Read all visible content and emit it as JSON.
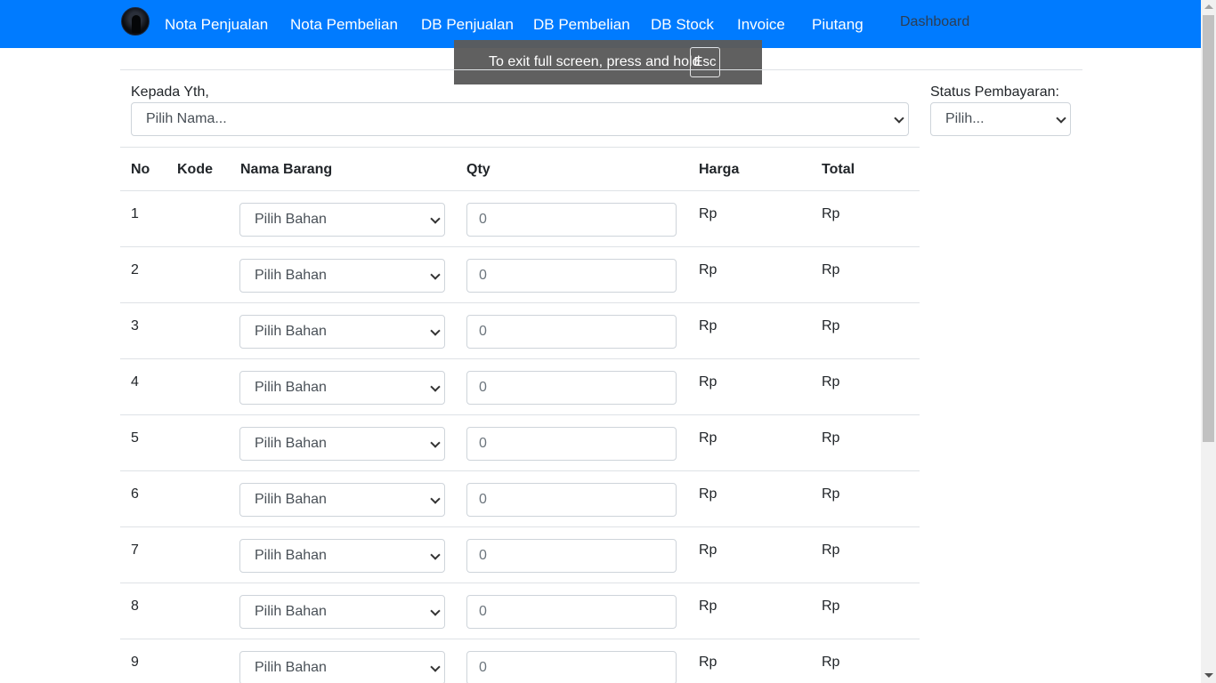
{
  "navbar": {
    "links": [
      "Nota Penjualan",
      "Nota Pembelian",
      "DB Penjualan",
      "DB Pembelian",
      "DB Stock",
      "Invoice",
      "Piutang"
    ],
    "dashboard": "Dashboard",
    "color": "#007bff"
  },
  "toast": {
    "text": "To exit full screen, press and hold",
    "key": "Esc"
  },
  "form": {
    "recipient_label": "Kepada Yth,",
    "recipient_value": "Pilih Nama...",
    "status_label": "Status Pembayaran:",
    "status_value": "Pilih..."
  },
  "table": {
    "headers": {
      "no": "No",
      "code": "Kode",
      "name": "Nama Barang",
      "qty": "Qty",
      "price": "Harga",
      "total": "Total"
    },
    "rows": [
      {
        "no": "1",
        "item": "Pilih Bahan",
        "qty": "0",
        "price": "Rp",
        "total": "Rp"
      },
      {
        "no": "2",
        "item": "Pilih Bahan",
        "qty": "0",
        "price": "Rp",
        "total": "Rp"
      },
      {
        "no": "3",
        "item": "Pilih Bahan",
        "qty": "0",
        "price": "Rp",
        "total": "Rp"
      },
      {
        "no": "4",
        "item": "Pilih Bahan",
        "qty": "0",
        "price": "Rp",
        "total": "Rp"
      },
      {
        "no": "5",
        "item": "Pilih Bahan",
        "qty": "0",
        "price": "Rp",
        "total": "Rp"
      },
      {
        "no": "6",
        "item": "Pilih Bahan",
        "qty": "0",
        "price": "Rp",
        "total": "Rp"
      },
      {
        "no": "7",
        "item": "Pilih Bahan",
        "qty": "0",
        "price": "Rp",
        "total": "Rp"
      },
      {
        "no": "8",
        "item": "Pilih Bahan",
        "qty": "0",
        "price": "Rp",
        "total": "Rp"
      },
      {
        "no": "9",
        "item": "Pilih Bahan",
        "qty": "0",
        "price": "Rp",
        "total": "Rp"
      }
    ]
  }
}
